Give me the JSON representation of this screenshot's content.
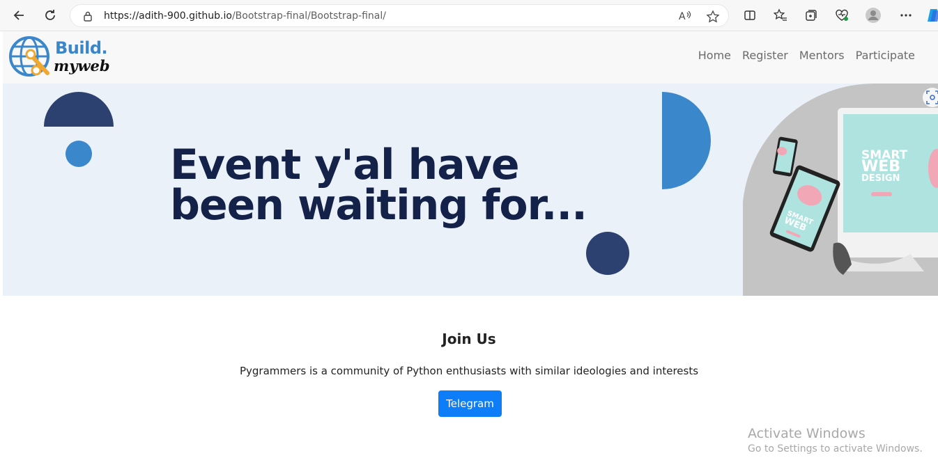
{
  "browser": {
    "url_host": "https://adith-900.github.io",
    "url_path": "/Bootstrap-final/Bootstrap-final/",
    "icons": [
      "back-icon",
      "refresh-icon",
      "lock-icon",
      "read-aloud-icon",
      "favorite-star-icon",
      "split-screen-icon",
      "favorites-icon",
      "collections-icon",
      "browser-essentials-icon",
      "profile-icon",
      "more-icon",
      "copilot-icon"
    ]
  },
  "site": {
    "brand_line1": "Build.",
    "brand_line2": "myweb",
    "nav": [
      "Home",
      "Register",
      "Mentors",
      "Participate"
    ]
  },
  "hero": {
    "title_line1": "Event y'al have",
    "title_line2": "been waiting for...",
    "colors": {
      "dark": "#2c4170",
      "accent": "#3b87cb",
      "background": "#eaf1f9",
      "title": "#14224a"
    },
    "image_text": [
      "SMART",
      "WEB",
      "DESIGN"
    ]
  },
  "join": {
    "title": "Join Us",
    "text": "Pygrammers is a community of Python enthusiasts with similar ideologies and interests",
    "button": "Telegram",
    "button_color": "#0d7ef7"
  },
  "watermark": {
    "line1": "Activate Windows",
    "line2": "Go to Settings to activate Windows."
  }
}
